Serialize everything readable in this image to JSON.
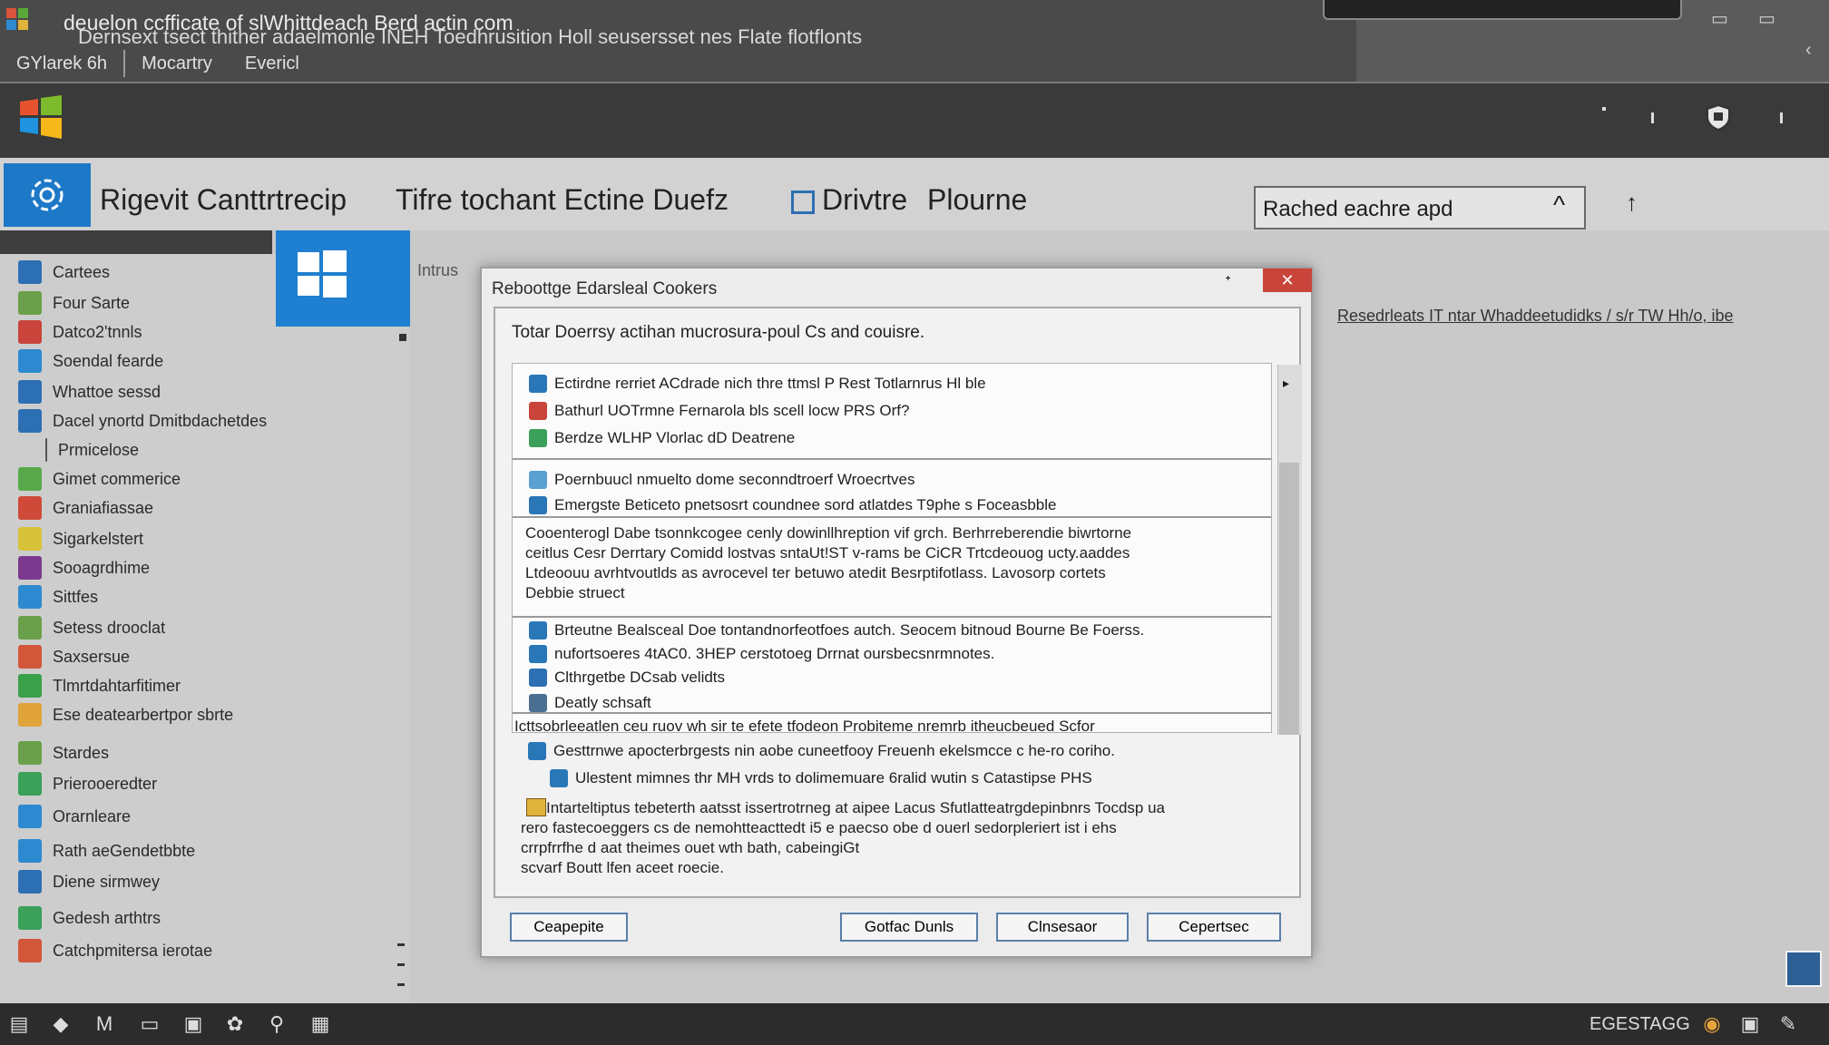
{
  "window": {
    "title": "deuelon ccfficate of slWhittdeach Berd actin com",
    "menu": [
      "GYlarek 6h",
      "Mocartry",
      "Evericl"
    ],
    "controls": [
      "▭",
      "▭",
      "‹"
    ]
  },
  "banner": {
    "text": "Dernsext tsect thither adaelmonle INEH Toedhrusition Holl seusersset nes Flate flotflonts"
  },
  "toolbar": {
    "titles": [
      "Rigevit Canttrtrecip",
      "Tifre tochant Ectine Duefz",
      "Drivtre",
      "Plourne"
    ],
    "combo_value": "Rached eachre apd",
    "combo_chevron": "^",
    "up_arrow": "↑"
  },
  "sidebar": {
    "items": [
      {
        "label": "Cartees",
        "color": "#2d6fb3"
      },
      {
        "label": "Four Sarte",
        "color": "#6aa04a"
      },
      {
        "label": "Datco2'tnnls",
        "color": "#c9443b"
      },
      {
        "label": "Soendal fearde",
        "color": "#2d8ad0"
      },
      {
        "label": "Whattoe sessd",
        "color": "#2d6fb3"
      },
      {
        "label": "Dacel ynortd Dmitbdachetdes",
        "color": "#2d6fb3"
      },
      {
        "label": "Prmicelose",
        "color": ""
      },
      {
        "label": "Gimet commerice",
        "color": "#58a84a"
      },
      {
        "label": "Graniafiassae",
        "color": "#d04a3a"
      },
      {
        "label": "Sigarkelstert",
        "color": "#d8c23a"
      },
      {
        "label": "Sooagrdhime",
        "color": "#7b3a8e"
      },
      {
        "label": "Sittfes",
        "color": "#2d8ad0"
      },
      {
        "label": "Setess drooclat",
        "color": "#6aa04a"
      },
      {
        "label": "Saxsersue",
        "color": "#d2563a"
      },
      {
        "label": "Tlmrtdahtarfitimer",
        "color": "#3aa04a"
      },
      {
        "label": "Ese deatearbertpor sbrte",
        "color": "#e0a43a"
      },
      {
        "label": "Stardes",
        "color": "#6aa04a"
      },
      {
        "label": "Prierooeredter",
        "color": "#3aa05a"
      },
      {
        "label": "Orarnleare",
        "color": "#2d8ad0"
      },
      {
        "label": "Rath aeGendetbbte",
        "color": "#2d8ad0"
      },
      {
        "label": "Diene sirmwey",
        "color": "#2d6fb3"
      },
      {
        "label": "Gedesh arthtrs",
        "color": "#3aa05a"
      },
      {
        "label": "Catchpmitersa ierotae",
        "color": "#d2563a"
      }
    ]
  },
  "right_link": "Resedrleats IT ntar Whaddeetudidks / s/r TW Hh/o, ibe",
  "left_fragment": "Intrus",
  "dialog": {
    "title": "Reboottge Edarsleal Cookers",
    "pin": "ᐩ",
    "close": "✕",
    "heading": "Totar Doerrsy actihan mucrosura-poul Cs and couisre.",
    "group1": [
      "Ectirdne rerriet ACdrade nich thre ttmsl P Rest Totlarnrus Hl ble",
      "Bathurl UOTrmne Fernarola bls scell locw PRS Orf?",
      "Berdze WLHP Vlorlac dD Deatrene"
    ],
    "group2": [
      "Poernbuucl nmuelto dome seconndtroerf Wroecrtves",
      "Emergste Beticeto pnetsosrt coundnee sord atlatdes T9phe s Foceasbble"
    ],
    "paragraph1": [
      "Cooenterogl Dabe tsonnkcogee cenly dowinllhreption vif grch. Berhrreberendie biwrtorne",
      "ceitlus Cesr Derrtary Comidd lostvas sntaUt!ST v-rams be CiCR Trtcdeouog ucty.aaddes",
      "Ltdeoouu avrhtvoutlds as avrocevel ter betuwo atedit Besrptifotlass. Lavosorp cortets",
      "Debbie struect"
    ],
    "group3": [
      "Brteutne Bealsceal Doe tontandnorfeotfoes autch. Seocem bitnoud Bourne Be Foerss.",
      "nufortsoeres 4tAC0. 3HEP cerstotoeg Drrnat oursbecsnrmnotes.",
      "Clthrgetbe DCsab velidts",
      "Deatly schsaft"
    ],
    "overflow_line": "Icttsobrleeatlen ceu ruov wh sir te efete tfodeon Probiteme nremrb itheucbeued Scfor",
    "group4": [
      "Gesttrnwe apocterbrgests nin aobe cuneetfooy Freuenh ekelsmcce c he-ro coriho.",
      "Ulestent mimnes thr MH vrds to dolimemuare 6ralid wutin s Catastipse PHS"
    ],
    "paragraph2": [
      "Intarteltiptus tebeterth aatsst issertrotrneg at aipee Lacus Sfutlatteatrgdepinbnrs Tocdsp ua",
      "rero fastecoeggers cs de nemohtteacttedt i5 e paecso obe d ouerl sedorpleriert ist i ehs",
      "crrpfrrfhe d aat theimes ouet wth bath, cabeingiGt",
      "scvarf Boutt lfen aceet roecie."
    ],
    "buttons": [
      "Ceapepite",
      "Gotfac Dunls",
      "Clnsesaor",
      "Cepertsec"
    ]
  },
  "taskbar": {
    "icons": [
      "▤",
      "◆",
      "M",
      "▭",
      "▣",
      "✿",
      "⚲",
      "▦"
    ],
    "tray_text": "EGESTAGG",
    "tray_icons": [
      "◉",
      "▣",
      "✎"
    ]
  }
}
